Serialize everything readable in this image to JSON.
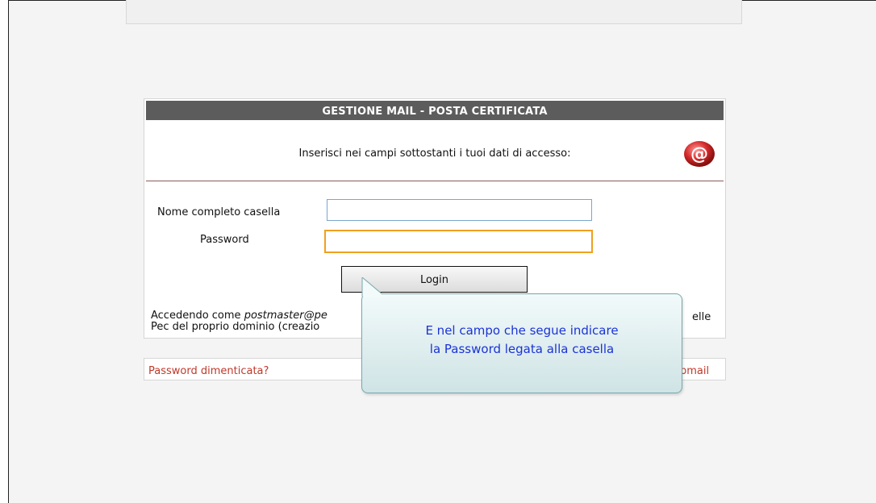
{
  "login": {
    "header": "GESTIONE MAIL - POSTA CERTIFICATA",
    "intro": "Inserisci nei campi sottostanti i tuoi dati di accesso:",
    "mailbox_label": "Nome completo casella",
    "mailbox_value": "",
    "password_label": "Password",
    "password_value": "",
    "login_button": "Login",
    "info_prefix": "Accedendo come ",
    "info_italic": "postmaster@pe",
    "info_line2": "Pec del proprio dominio (creazio",
    "info_right": "elle",
    "forgot_link": "Password dimenticata?",
    "webmail_link": "bmail"
  },
  "tooltip": {
    "line1": "E nel campo che segue indicare",
    "line2": "la Password legata alla casella"
  },
  "colors": {
    "header_bg": "#5c5c5c",
    "focus_border": "#f0a020",
    "link": "#c0392b",
    "tooltip_text": "#1a33d6"
  }
}
